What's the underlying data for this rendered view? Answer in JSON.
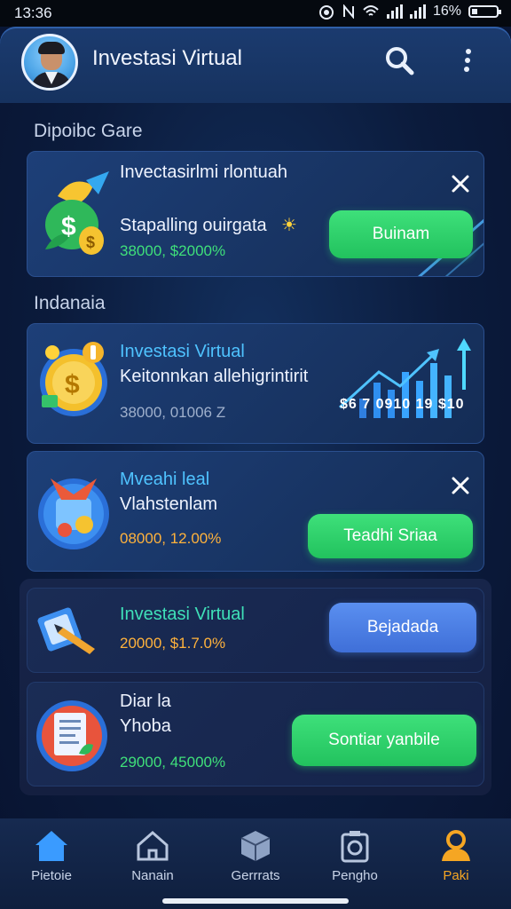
{
  "status_bar": {
    "time": "13:36",
    "battery": "16%"
  },
  "app": {
    "title": "Investasi Virtual"
  },
  "sections": {
    "first": "Dipoibc Gare",
    "second": "Indanaia"
  },
  "cards": [
    {
      "title": "Invectasirlmi rlontuah",
      "subtitle": "Stapalling ouirgata",
      "sparkle": "☀",
      "stats": "38000, $2000%",
      "button": "Buinam",
      "closable": true
    },
    {
      "title": "Investasi Virtual",
      "subtitle": "Keitonnkan allehigrintirit",
      "stats": "38000, 01006 Z",
      "chart_label": "$6 7 0910 19 $10",
      "closable": false
    },
    {
      "title": "Mveahi leal",
      "subtitle": "Vlahstenlam",
      "stats": "08000, 12.00%",
      "button": "Teadhi Sriaa",
      "closable": true
    },
    {
      "title": "Investasi Virtual",
      "stats": "20000, $1.7.0%",
      "button": "Bejadada",
      "closable": false
    },
    {
      "title": "Diar la",
      "subtitle": "Yhoba",
      "stats": "29000, 45000%",
      "button": "Sontiar yanbile",
      "closable": false
    }
  ],
  "colors": {
    "accent_green": "#22c25e",
    "accent_blue": "#3f6fd8",
    "cyan_text": "#4fc3ff",
    "teal_text": "#3fe0b8",
    "orange_text": "#ffb23c"
  },
  "nav": [
    {
      "label": "Pietoie",
      "icon": "home-icon",
      "active": true
    },
    {
      "label": "Nanain",
      "icon": "house-outline-icon"
    },
    {
      "label": "Gerrrats",
      "icon": "box-icon"
    },
    {
      "label": "Pengho",
      "icon": "camera-icon"
    },
    {
      "label": "Paki",
      "icon": "user-icon"
    }
  ]
}
